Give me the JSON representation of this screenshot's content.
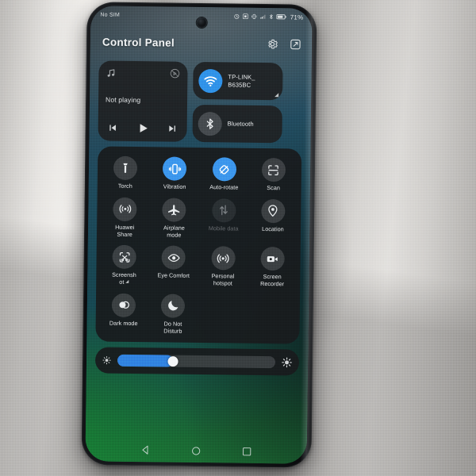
{
  "statusbar": {
    "carrier": "No SIM",
    "icons": [
      "alarm-icon",
      "screenshot-icon",
      "vibrate-icon",
      "signal-icon",
      "bluetooth-icon",
      "battery-icon"
    ],
    "battery_percent": "71%"
  },
  "panel": {
    "title": "Control Panel",
    "header_icons": [
      "settings-gear-icon",
      "edit-panel-icon"
    ]
  },
  "media": {
    "status": "Not playing",
    "note_icon": "music-note-icon",
    "cast_icon": "cast-audio-icon",
    "prev_label": "previous-track",
    "play_label": "play",
    "next_label": "next-track"
  },
  "connectivity": [
    {
      "name": "wifi",
      "icon": "wifi-icon",
      "label": "TP-LINK_\nB635BC",
      "label_line1": "TP-LINK_",
      "label_line2": "B635BC",
      "state": "on",
      "expandable": true
    },
    {
      "name": "bluetooth",
      "icon": "bluetooth-icon",
      "label_line1": "Bluetooth",
      "label_line2": "",
      "state": "off",
      "expandable": false
    }
  ],
  "tiles": [
    {
      "label": "Torch",
      "icon": "flashlight-icon",
      "state": "off"
    },
    {
      "label": "Vibration",
      "icon": "vibrate-icon",
      "state": "on"
    },
    {
      "label": "Auto-rotate",
      "icon": "auto-rotate-off-icon",
      "state": "on"
    },
    {
      "label": "Scan",
      "icon": "scan-icon",
      "state": "off"
    },
    {
      "label": "Huawei\nShare",
      "icon": "huawei-share-icon",
      "state": "off"
    },
    {
      "label": "Airplane\nmode",
      "icon": "airplane-icon",
      "state": "off"
    },
    {
      "label": "Mobile data",
      "icon": "mobile-data-icon",
      "state": "disabled"
    },
    {
      "label": "Location",
      "icon": "location-pin-icon",
      "state": "off"
    },
    {
      "label": "Screensh\not",
      "icon": "screenshot-icon",
      "state": "off",
      "expandable": true
    },
    {
      "label": "Eye Comfort",
      "icon": "eye-comfort-icon",
      "state": "off"
    },
    {
      "label": "Personal\nhotspot",
      "icon": "hotspot-icon",
      "state": "off"
    },
    {
      "label": "Screen\nRecorder",
      "icon": "screen-recorder-icon",
      "state": "off"
    },
    {
      "label": "Dark mode",
      "icon": "dark-mode-icon",
      "state": "off"
    },
    {
      "label": "Do Not\nDisturb",
      "icon": "moon-icon",
      "state": "off"
    }
  ],
  "brightness": {
    "value_percent": 35,
    "low_icon": "sun-small-icon",
    "high_icon": "sun-large-icon"
  },
  "navbar": [
    {
      "name": "back-button",
      "icon": "triangle-back-icon"
    },
    {
      "name": "home-button",
      "icon": "circle-home-icon"
    },
    {
      "name": "recents-button",
      "icon": "square-recents-icon"
    }
  ],
  "colors": {
    "accent_blue": "#3a93ec",
    "wifi_blue": "#2e8fe8",
    "slider_blue": "#2f7fe0",
    "card_bg": "#1e2022",
    "text": "#e4e7e9"
  }
}
